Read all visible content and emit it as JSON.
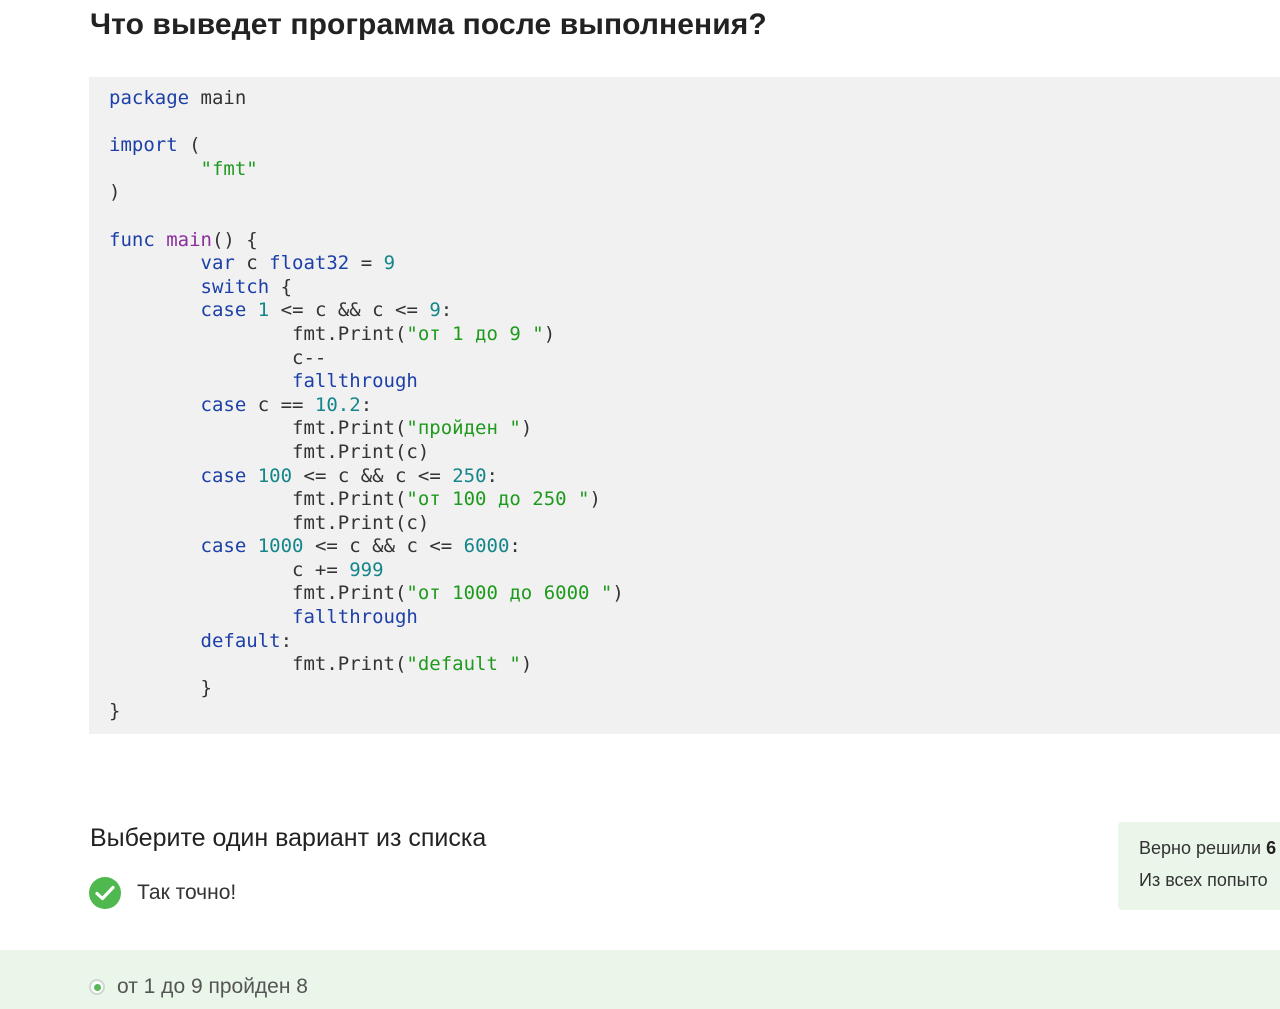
{
  "question": {
    "title": "Что выведет программа после выполнения?"
  },
  "code": {
    "line1_kw": "package",
    "line1_rest": " main",
    "line2_kw": "import",
    "line2_rest": " (",
    "line3_str": "\"fmt\"",
    "line4": ")",
    "line5_kw": "func",
    "line5_fn": "main",
    "line5_rest": "() {",
    "line6_kw": "var",
    "line6_mid": " c ",
    "line6_type": "float32",
    "line6_eq": " = ",
    "line6_num": "9",
    "line7_kw": "switch",
    "line7_rest": " {",
    "line8_kw": "case",
    "line8_num1": "1",
    "line8_mid": " <= c && c <= ",
    "line8_num2": "9",
    "line8_end": ":",
    "line9_pre": "fmt.Print(",
    "line9_str": "\"от 1 до 9 \"",
    "line9_end": ")",
    "line10": "c--",
    "line11_kw": "fallthrough",
    "line12_kw": "case",
    "line12_mid": " c == ",
    "line12_num": "10.2",
    "line12_end": ":",
    "line13_pre": "fmt.Print(",
    "line13_str": "\"пройден \"",
    "line13_end": ")",
    "line14": "fmt.Print(c)",
    "line15_kw": "case",
    "line15_num1": "100",
    "line15_mid": " <= c && c <= ",
    "line15_num2": "250",
    "line15_end": ":",
    "line16_pre": "fmt.Print(",
    "line16_str": "\"от 100 до 250 \"",
    "line16_end": ")",
    "line17": "fmt.Print(c)",
    "line18_kw": "case",
    "line18_num1": "1000",
    "line18_mid": " <= c && c <= ",
    "line18_num2": "6000",
    "line18_end": ":",
    "line19_pre": "c += ",
    "line19_num": "999",
    "line20_pre": "fmt.Print(",
    "line20_str": "\"от 1000 до 6000 \"",
    "line20_end": ")",
    "line21_kw": "fallthrough",
    "line22_kw": "default",
    "line22_end": ":",
    "line23_pre": "fmt.Print(",
    "line23_str": "\"default \"",
    "line23_end": ")",
    "line24": "}",
    "line25": "}"
  },
  "answers": {
    "section_title": "Выберите один вариант из списка",
    "result_text": "Так точно!",
    "selected_option": "от 1 до 9 пройден 8"
  },
  "stats": {
    "solved_label": "Верно решили ",
    "solved_value": "6",
    "attempts_label": "Из всех попыто"
  },
  "colors": {
    "success": "#4fb84f",
    "success_bg": "#e9f6e9",
    "code_bg": "#f1f1f1",
    "keyword": "#1c3fa8",
    "string": "#1e9a1e",
    "number": "#14868a"
  }
}
